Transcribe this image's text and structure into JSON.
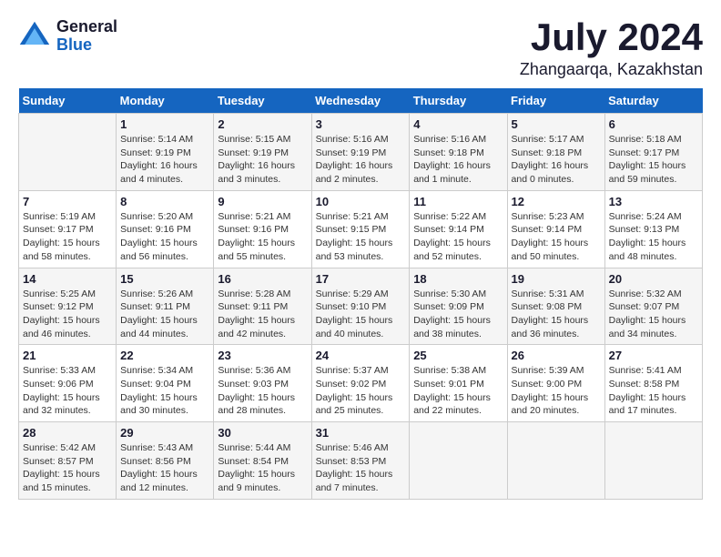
{
  "header": {
    "logo_general": "General",
    "logo_blue": "Blue",
    "month": "July 2024",
    "location": "Zhangaarqa, Kazakhstan"
  },
  "weekdays": [
    "Sunday",
    "Monday",
    "Tuesday",
    "Wednesday",
    "Thursday",
    "Friday",
    "Saturday"
  ],
  "weeks": [
    [
      {
        "day": "",
        "info": ""
      },
      {
        "day": "1",
        "info": "Sunrise: 5:14 AM\nSunset: 9:19 PM\nDaylight: 16 hours\nand 4 minutes."
      },
      {
        "day": "2",
        "info": "Sunrise: 5:15 AM\nSunset: 9:19 PM\nDaylight: 16 hours\nand 3 minutes."
      },
      {
        "day": "3",
        "info": "Sunrise: 5:16 AM\nSunset: 9:19 PM\nDaylight: 16 hours\nand 2 minutes."
      },
      {
        "day": "4",
        "info": "Sunrise: 5:16 AM\nSunset: 9:18 PM\nDaylight: 16 hours\nand 1 minute."
      },
      {
        "day": "5",
        "info": "Sunrise: 5:17 AM\nSunset: 9:18 PM\nDaylight: 16 hours\nand 0 minutes."
      },
      {
        "day": "6",
        "info": "Sunrise: 5:18 AM\nSunset: 9:17 PM\nDaylight: 15 hours\nand 59 minutes."
      }
    ],
    [
      {
        "day": "7",
        "info": "Sunrise: 5:19 AM\nSunset: 9:17 PM\nDaylight: 15 hours\nand 58 minutes."
      },
      {
        "day": "8",
        "info": "Sunrise: 5:20 AM\nSunset: 9:16 PM\nDaylight: 15 hours\nand 56 minutes."
      },
      {
        "day": "9",
        "info": "Sunrise: 5:21 AM\nSunset: 9:16 PM\nDaylight: 15 hours\nand 55 minutes."
      },
      {
        "day": "10",
        "info": "Sunrise: 5:21 AM\nSunset: 9:15 PM\nDaylight: 15 hours\nand 53 minutes."
      },
      {
        "day": "11",
        "info": "Sunrise: 5:22 AM\nSunset: 9:14 PM\nDaylight: 15 hours\nand 52 minutes."
      },
      {
        "day": "12",
        "info": "Sunrise: 5:23 AM\nSunset: 9:14 PM\nDaylight: 15 hours\nand 50 minutes."
      },
      {
        "day": "13",
        "info": "Sunrise: 5:24 AM\nSunset: 9:13 PM\nDaylight: 15 hours\nand 48 minutes."
      }
    ],
    [
      {
        "day": "14",
        "info": "Sunrise: 5:25 AM\nSunset: 9:12 PM\nDaylight: 15 hours\nand 46 minutes."
      },
      {
        "day": "15",
        "info": "Sunrise: 5:26 AM\nSunset: 9:11 PM\nDaylight: 15 hours\nand 44 minutes."
      },
      {
        "day": "16",
        "info": "Sunrise: 5:28 AM\nSunset: 9:11 PM\nDaylight: 15 hours\nand 42 minutes."
      },
      {
        "day": "17",
        "info": "Sunrise: 5:29 AM\nSunset: 9:10 PM\nDaylight: 15 hours\nand 40 minutes."
      },
      {
        "day": "18",
        "info": "Sunrise: 5:30 AM\nSunset: 9:09 PM\nDaylight: 15 hours\nand 38 minutes."
      },
      {
        "day": "19",
        "info": "Sunrise: 5:31 AM\nSunset: 9:08 PM\nDaylight: 15 hours\nand 36 minutes."
      },
      {
        "day": "20",
        "info": "Sunrise: 5:32 AM\nSunset: 9:07 PM\nDaylight: 15 hours\nand 34 minutes."
      }
    ],
    [
      {
        "day": "21",
        "info": "Sunrise: 5:33 AM\nSunset: 9:06 PM\nDaylight: 15 hours\nand 32 minutes."
      },
      {
        "day": "22",
        "info": "Sunrise: 5:34 AM\nSunset: 9:04 PM\nDaylight: 15 hours\nand 30 minutes."
      },
      {
        "day": "23",
        "info": "Sunrise: 5:36 AM\nSunset: 9:03 PM\nDaylight: 15 hours\nand 28 minutes."
      },
      {
        "day": "24",
        "info": "Sunrise: 5:37 AM\nSunset: 9:02 PM\nDaylight: 15 hours\nand 25 minutes."
      },
      {
        "day": "25",
        "info": "Sunrise: 5:38 AM\nSunset: 9:01 PM\nDaylight: 15 hours\nand 22 minutes."
      },
      {
        "day": "26",
        "info": "Sunrise: 5:39 AM\nSunset: 9:00 PM\nDaylight: 15 hours\nand 20 minutes."
      },
      {
        "day": "27",
        "info": "Sunrise: 5:41 AM\nSunset: 8:58 PM\nDaylight: 15 hours\nand 17 minutes."
      }
    ],
    [
      {
        "day": "28",
        "info": "Sunrise: 5:42 AM\nSunset: 8:57 PM\nDaylight: 15 hours\nand 15 minutes."
      },
      {
        "day": "29",
        "info": "Sunrise: 5:43 AM\nSunset: 8:56 PM\nDaylight: 15 hours\nand 12 minutes."
      },
      {
        "day": "30",
        "info": "Sunrise: 5:44 AM\nSunset: 8:54 PM\nDaylight: 15 hours\nand 9 minutes."
      },
      {
        "day": "31",
        "info": "Sunrise: 5:46 AM\nSunset: 8:53 PM\nDaylight: 15 hours\nand 7 minutes."
      },
      {
        "day": "",
        "info": ""
      },
      {
        "day": "",
        "info": ""
      },
      {
        "day": "",
        "info": ""
      }
    ]
  ]
}
